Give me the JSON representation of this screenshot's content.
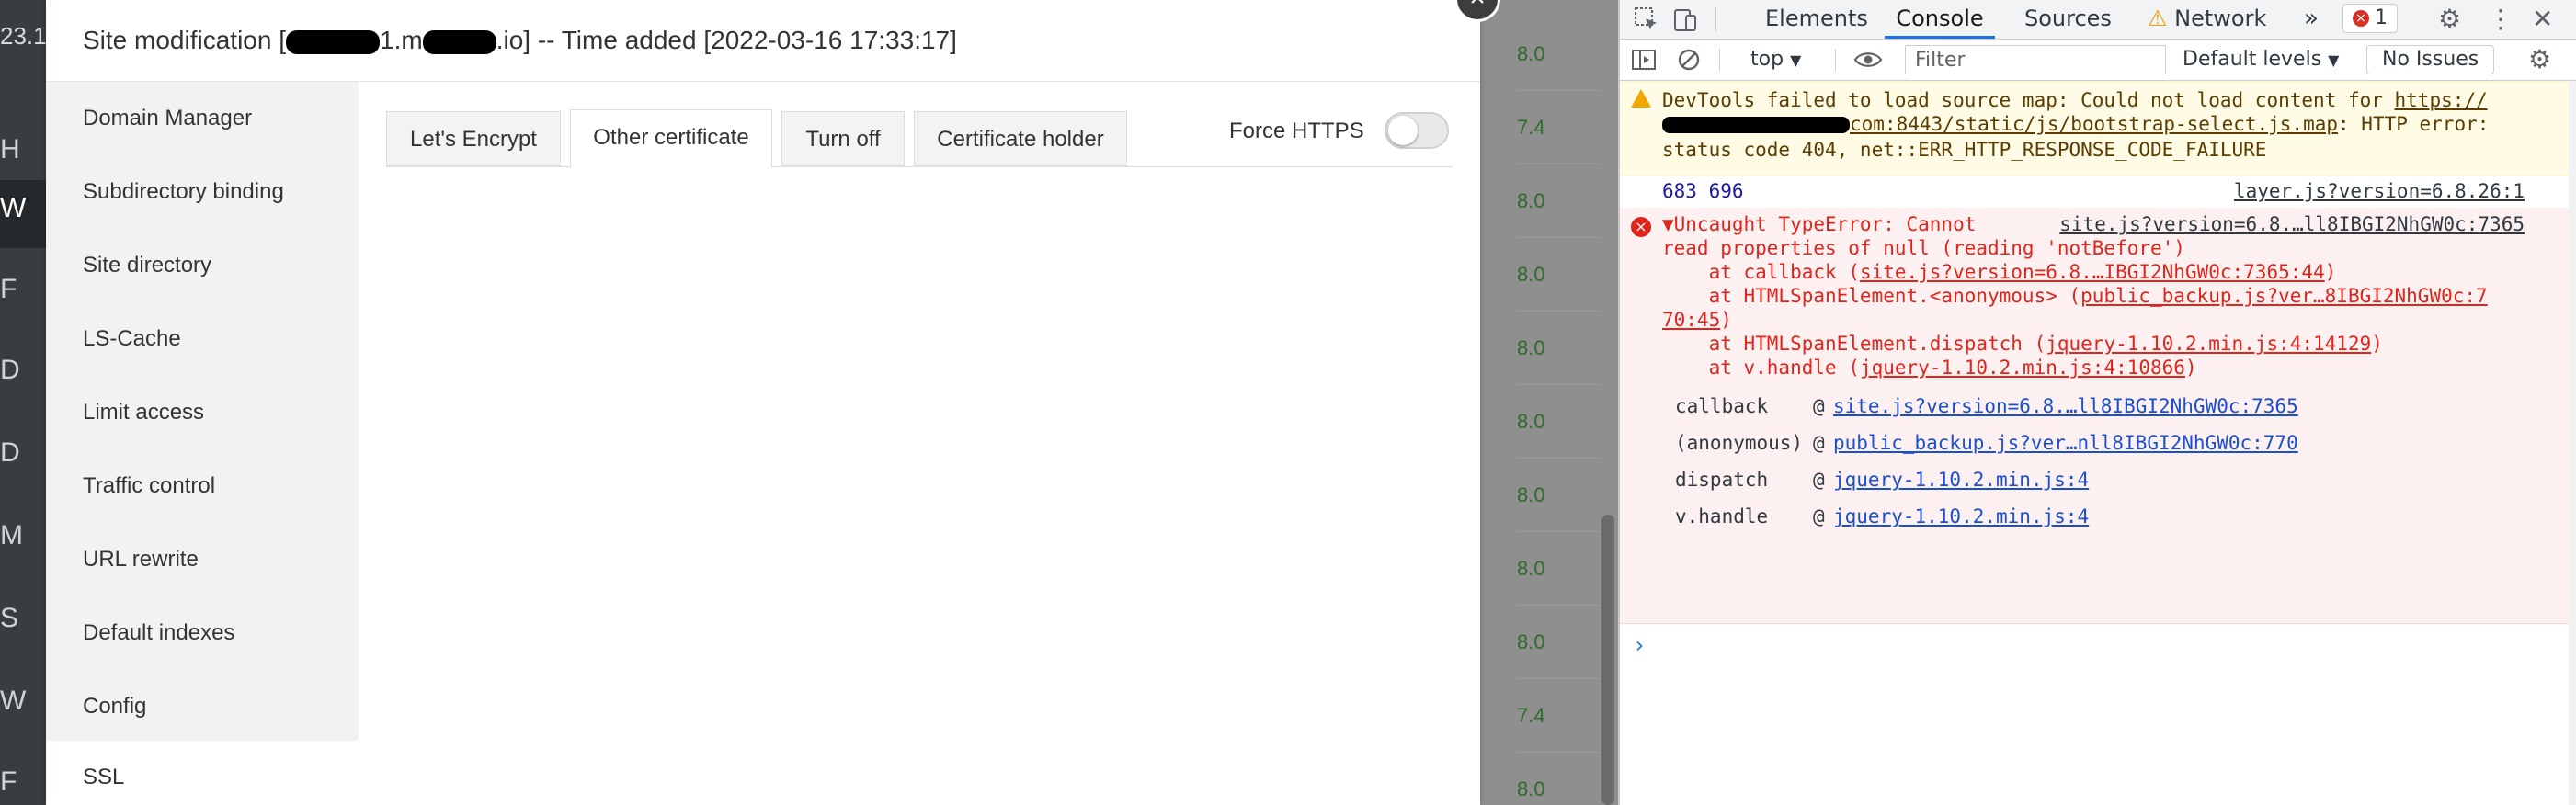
{
  "background_app": {
    "top_text": "23.1",
    "sidebar_letters": [
      "H",
      "W",
      "F",
      "D",
      "D",
      "M",
      "S",
      "W",
      "F"
    ]
  },
  "background_numbers": [
    "8.0",
    "7.4",
    "8.0",
    "8.0",
    "8.0",
    "8.0",
    "8.0",
    "8.0",
    "8.0",
    "7.4",
    "8.0"
  ],
  "modal": {
    "title_prefix": "Site modification [",
    "title_mid1": "1.m",
    "title_mid2": ".io] -- Time added [2022-03-16 17:33:17]",
    "close_label": "×",
    "nav": [
      "Domain Manager",
      "Subdirectory binding",
      "Site directory",
      "LS-Cache",
      "Limit access",
      "Traffic control",
      "URL rewrite",
      "Default indexes",
      "Config",
      "SSL"
    ],
    "tabs": [
      "Let's Encrypt",
      "Other certificate",
      "Turn off",
      "Certificate holder"
    ],
    "active_tab": "Other certificate",
    "force_https_label": "Force HTTPS",
    "force_https_on": false
  },
  "devtools": {
    "tabs": [
      "Elements",
      "Console",
      "Sources",
      "Network"
    ],
    "active_tab": "Console",
    "more_label": "»",
    "error_count": "1",
    "context": "top",
    "filter_placeholder": "Filter",
    "levels": "Default levels",
    "issues": "No Issues",
    "warning": {
      "line1": "DevTools failed to load source map: Could not load content for ",
      "line1_link": "https://",
      "line2_link": "com:8443/static/js/bootstrap-select.js.map",
      "line2_rest": ": HTTP error:",
      "line3": "status code 404, net::ERR_HTTP_RESPONSE_CODE_FAILURE"
    },
    "log": {
      "value": "683 696",
      "source": "layer.js?version=6.8.26:1"
    },
    "error": {
      "line1": "▼Uncaught TypeError: Cannot",
      "source": "site.js?version=6.8.…ll8IBGI2NhGW0c:7365",
      "line2": "read properties of null (reading 'notBefore')",
      "trace": [
        {
          "prefix": "    at callback (",
          "link": "site.js?version=6.8.…IBGI2NhGW0c:7365:44",
          "suffix": ")"
        },
        {
          "prefix": "    at HTMLSpanElement.<anonymous> (",
          "link": "public_backup.js?ver…8IBGI2NhGW0c:7",
          "suffix": ""
        },
        {
          "prefix": "",
          "link": "70:45",
          "suffix": ")"
        },
        {
          "prefix": "    at HTMLSpanElement.dispatch (",
          "link": "jquery-1.10.2.min.js:4:14129",
          "suffix": ")"
        },
        {
          "prefix": "    at v.handle (",
          "link": "jquery-1.10.2.min.js:4:10866",
          "suffix": ")"
        }
      ],
      "stack": [
        {
          "fn": "callback",
          "at": "@",
          "link": "site.js?version=6.8.…ll8IBGI2NhGW0c:7365"
        },
        {
          "fn": "(anonymous)",
          "at": "@",
          "link": "public_backup.js?ver…nll8IBGI2NhGW0c:770"
        },
        {
          "fn": "dispatch",
          "at": "@",
          "link": "jquery-1.10.2.min.js:4"
        },
        {
          "fn": "v.handle",
          "at": "@",
          "link": "jquery-1.10.2.min.js:4"
        }
      ]
    },
    "prompt": "›"
  }
}
